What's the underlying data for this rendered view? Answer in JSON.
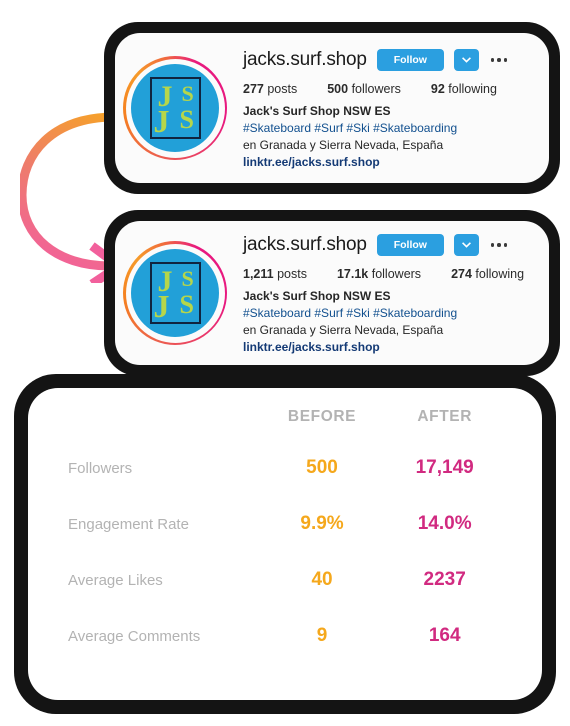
{
  "arrow": {
    "name": "before-after-arrow",
    "gradient_from": "#f6a12a",
    "gradient_to": "#f2609c"
  },
  "profiles": [
    {
      "key": "before",
      "username": "jacks.surf.shop",
      "follow_label": "Follow",
      "caret_icon": "chevron-down-icon",
      "more_icon": "more-options-icon",
      "stats": [
        {
          "value": "277",
          "label": "posts"
        },
        {
          "value": "500",
          "label": "followers"
        },
        {
          "value": "92",
          "label": "following"
        }
      ],
      "bio": {
        "display_name": "Jack's Surf Shop NSW ES",
        "hashtags": "#Skateboard #Surf #Ski #Skateboarding",
        "location": "en Granada y Sierra Nevada, España",
        "link": "linktr.ee/jacks.surf.shop"
      }
    },
    {
      "key": "after",
      "username": "jacks.surf.shop",
      "follow_label": "Follow",
      "caret_icon": "chevron-down-icon",
      "more_icon": "more-options-icon",
      "stats": [
        {
          "value": "1,211",
          "label": "posts"
        },
        {
          "value": "17.1k",
          "label": "followers"
        },
        {
          "value": "274",
          "label": "following"
        }
      ],
      "bio": {
        "display_name": "Jack's Surf Shop NSW ES",
        "hashtags": "#Skateboard #Surf #Ski #Skateboarding",
        "location": "en Granada y Sierra Nevada, España",
        "link": "linktr.ee/jacks.surf.shop"
      }
    }
  ],
  "avatar": {
    "monogram_letters": [
      "J",
      "S",
      "J",
      "S"
    ],
    "ring_color_start": "#e8197f",
    "ring_color_end": "#f58020",
    "disc_color": "#22a0d8",
    "letter_color": "#b6d64a",
    "frame_color": "#10243f"
  },
  "comparison": {
    "columns": [
      "BEFORE",
      "AFTER"
    ],
    "column_colors": {
      "before": "#f5a81c",
      "after": "#d12a80"
    },
    "rows": [
      {
        "label": "Followers",
        "before": "500",
        "after": "17,149"
      },
      {
        "label": "Engagement Rate",
        "before": "9.9%",
        "after": "14.0%"
      },
      {
        "label": "Average Likes",
        "before": "40",
        "after": "2237"
      },
      {
        "label": "Average Comments",
        "before": "9",
        "after": "164"
      }
    ]
  },
  "chart_data": {
    "type": "table",
    "title": "",
    "categories": [
      "Followers",
      "Engagement Rate",
      "Average Likes",
      "Average Comments"
    ],
    "series": [
      {
        "name": "BEFORE",
        "values": [
          500,
          9.9,
          40,
          9
        ]
      },
      {
        "name": "AFTER",
        "values": [
          17149,
          14.0,
          2237,
          164
        ]
      }
    ],
    "display_values": {
      "BEFORE": [
        "500",
        "9.9%",
        "40",
        "9"
      ],
      "AFTER": [
        "17,149",
        "14.0%",
        "2237",
        "164"
      ]
    },
    "xlabel": "",
    "ylabel": "",
    "legend_position": "top"
  }
}
